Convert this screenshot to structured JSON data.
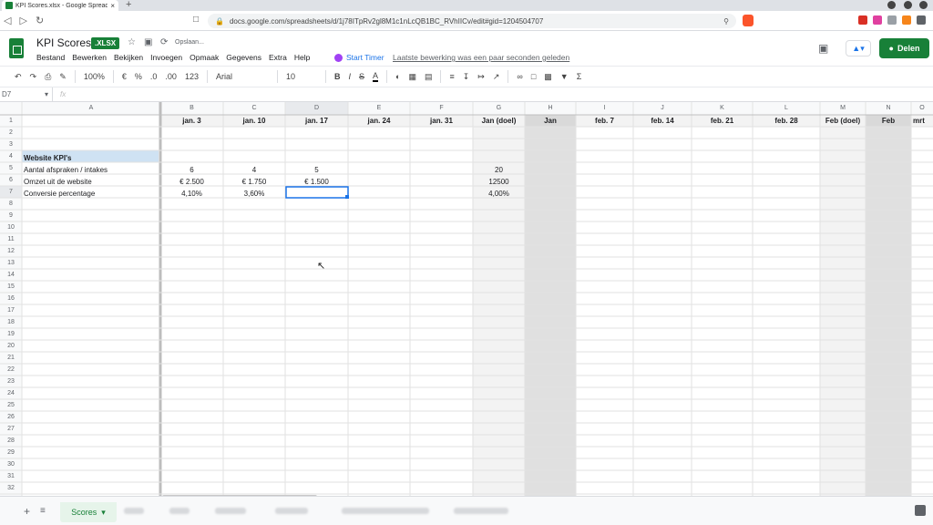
{
  "browser": {
    "tab_title": "KPI Scores.xlsx - Google Spreadsheets",
    "new_tab": "+",
    "close_tab": "×",
    "url": "docs.google.com/spreadsheets/d/1j78ITpRv2gl8M1c1nLcQB1BC_RVhIICv/edit#gid=1204504707"
  },
  "doc": {
    "title": "KPI Scores",
    "badge": ".XLSX",
    "saving": "Opslaan...",
    "menus": [
      "Bestand",
      "Bewerken",
      "Bekijken",
      "Invoegen",
      "Opmaak",
      "Gegevens",
      "Extra",
      "Help"
    ],
    "start_timer": "Start Timer",
    "last_edit": "Laatste bewerking was een paar seconden geleden",
    "share": "Delen"
  },
  "toolbar": {
    "zoom": "100%",
    "currency": "€",
    "percent": "%",
    "dec_less": ".0",
    "dec_more": ".00",
    "format": "123",
    "font": "Arial",
    "size": "10",
    "bold": "B",
    "italic": "I",
    "strike": "S",
    "text_color": "A"
  },
  "formula": {
    "cell_ref": "D7",
    "fx": "fx"
  },
  "columns": [
    "A",
    "B",
    "C",
    "D",
    "E",
    "F",
    "G",
    "H",
    "I",
    "J",
    "K",
    "L",
    "M",
    "N",
    "O"
  ],
  "headers_row1": [
    "",
    "jan. 3",
    "jan. 10",
    "jan. 17",
    "jan. 24",
    "jan. 31",
    "Jan (doel)",
    "Jan",
    "feb. 7",
    "feb. 14",
    "feb. 21",
    "feb. 28",
    "Feb (doel)",
    "Feb",
    "mrt"
  ],
  "rows": {
    "r4": {
      "a": "Website KPI's"
    },
    "r5": {
      "a": "Aantal afspraken / intakes",
      "b": "6",
      "c": "4",
      "d": "5",
      "g": "20"
    },
    "r6": {
      "a": "Omzet uit de website",
      "b": "€ 2.500",
      "c": "€ 1.750",
      "d": "€ 1.500",
      "g": "12500"
    },
    "r7": {
      "a": "Conversie percentage",
      "b": "4,10%",
      "c": "3,60%",
      "g": "4,00%"
    }
  },
  "row_numbers": [
    "1",
    "2",
    "3",
    "4",
    "5",
    "6",
    "7",
    "8",
    "9",
    "10",
    "11",
    "12",
    "13",
    "14",
    "15",
    "16",
    "17",
    "18",
    "19",
    "20",
    "21",
    "22",
    "23",
    "24",
    "25",
    "26",
    "27",
    "28",
    "29",
    "30",
    "31",
    "32"
  ],
  "sheets": {
    "active": "Scores"
  },
  "colors": {
    "brand": "#188038",
    "link": "#1a73e8",
    "selection": "#1a73e8",
    "month_col": "#e0e0e0",
    "goal_col": "#f3f3f3"
  }
}
